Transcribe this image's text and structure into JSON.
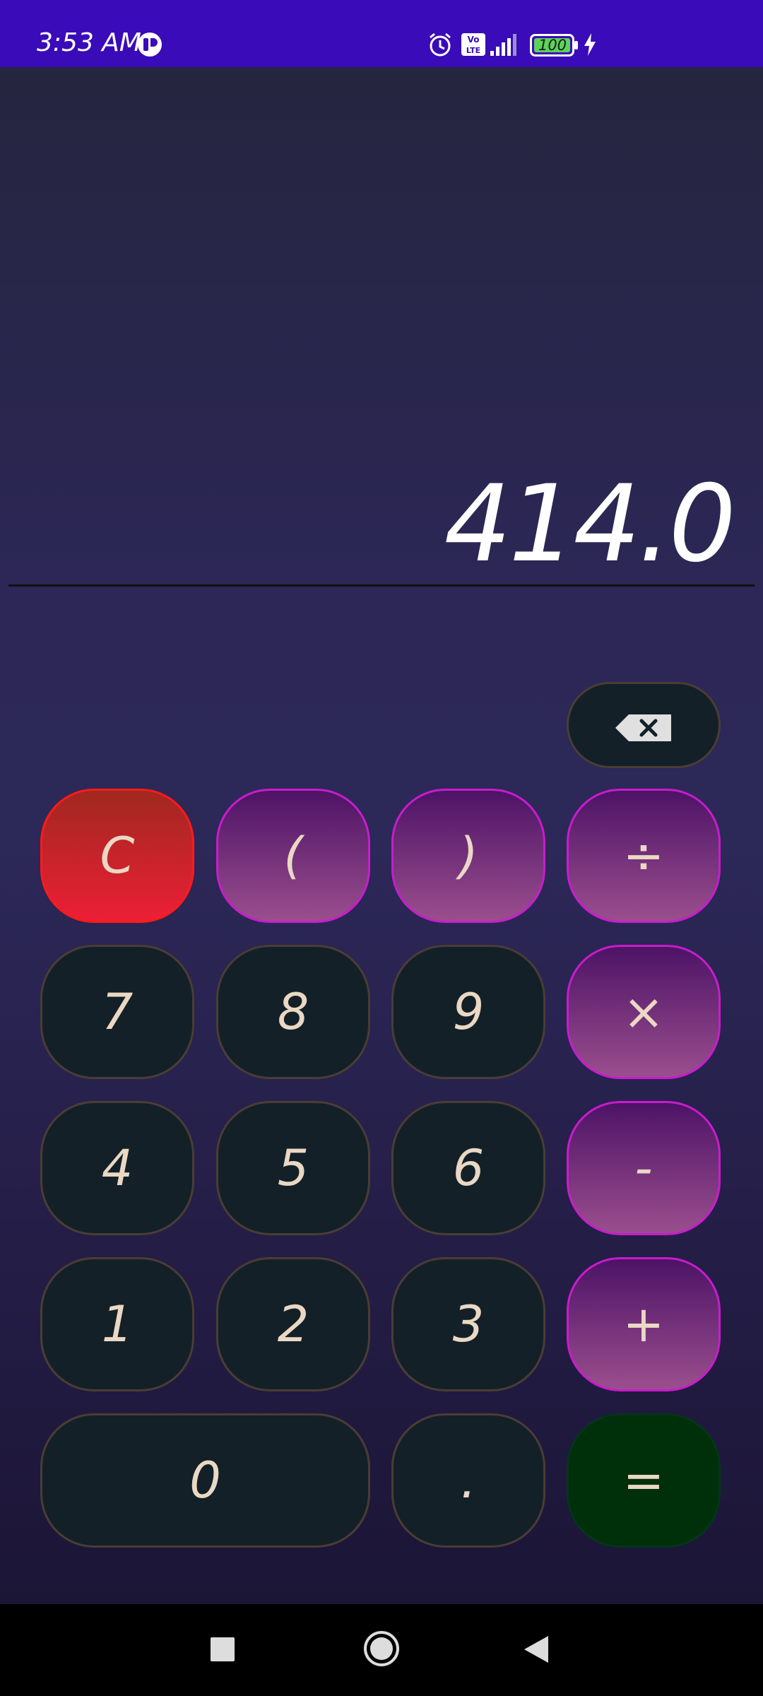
{
  "status_bar": {
    "time": "3:53 AM",
    "battery": "100",
    "icons": [
      "app-notification-icon",
      "alarm-icon",
      "volte-icon",
      "signal-icon",
      "battery-icon",
      "charging-icon"
    ]
  },
  "display": {
    "value": "414.0"
  },
  "keypad": {
    "backspace_icon": "backspace-icon",
    "rows": [
      [
        "C",
        "(",
        ")",
        "÷"
      ],
      [
        "7",
        "8",
        "9",
        "×"
      ],
      [
        "4",
        "5",
        "6",
        "-"
      ],
      [
        "1",
        "2",
        "3",
        "+"
      ],
      [
        "0",
        ".",
        "="
      ]
    ]
  },
  "colors": {
    "status_bar": "#3a0bb8",
    "number_key": "#132028",
    "operator_key": "#9a4e8d",
    "clear_key": "#ec1f36",
    "equals_key": "#00300a"
  },
  "nav_bar": {
    "icons": [
      "recents-icon",
      "home-icon",
      "back-icon"
    ]
  }
}
